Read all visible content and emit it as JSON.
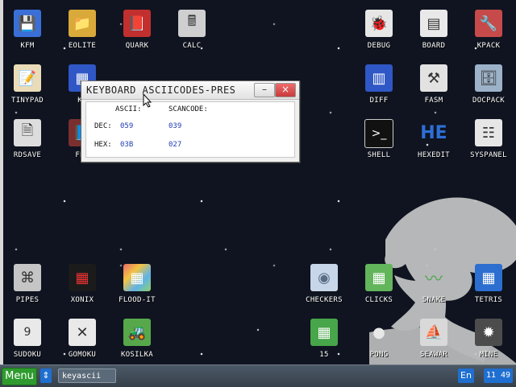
{
  "desktop": {
    "icons": [
      {
        "label": "KFM",
        "glyph": "💾",
        "color": "#3a6fd8"
      },
      {
        "label": "EOLITE",
        "glyph": "📁",
        "color": "#d9a93a"
      },
      {
        "label": "QUARK",
        "glyph": "📕",
        "color": "#c22f2f"
      },
      {
        "label": "CALC",
        "glyph": "🖩",
        "color": "#cfcfcf"
      },
      {
        "label": "DEBUG",
        "glyph": "🐞",
        "color": "#e6e6e6"
      },
      {
        "label": "BOARD",
        "glyph": "▤",
        "color": "#e9e9e9"
      },
      {
        "label": "KPACK",
        "glyph": "🔧",
        "color": "#c74a4a"
      },
      {
        "label": "TINYPAD",
        "glyph": "📝",
        "color": "#eadcb8"
      },
      {
        "label": "KF",
        "glyph": "▦",
        "color": "#2f57c5"
      },
      {
        "label": "DIFF",
        "glyph": "▥",
        "color": "#2f57c5"
      },
      {
        "label": "FASM",
        "glyph": "⚒",
        "color": "#e2e2e2"
      },
      {
        "label": "DOCPACK",
        "glyph": "🗄",
        "color": "#9cb2c8"
      },
      {
        "label": "RDSAVE",
        "glyph": "🗎",
        "color": "#dddddd"
      },
      {
        "label": "FB2",
        "glyph": "📘",
        "color": "#7a2f2f"
      },
      {
        "label": "SHELL",
        "glyph": ">_",
        "color": "#111111"
      },
      {
        "label": "HEXEDIT",
        "glyph": "HE",
        "color": "#2d6fd6"
      },
      {
        "label": "SYSPANEL",
        "glyph": "☷",
        "color": "#e6e6e6"
      },
      {
        "label": "PIPES",
        "glyph": "⌘",
        "color": "#c5c5c5"
      },
      {
        "label": "XONIX",
        "glyph": "▦",
        "color": "#1b1b1b"
      },
      {
        "label": "FLOOD-IT",
        "glyph": "▦",
        "color": "#e86a6a"
      },
      {
        "label": "CHECKERS",
        "glyph": "◉",
        "color": "#c7d6e8"
      },
      {
        "label": "CLICKS",
        "glyph": "▦",
        "color": "#62b55b"
      },
      {
        "label": "SNAKE",
        "glyph": "〰",
        "color": "#4fa64f"
      },
      {
        "label": "TETRIS",
        "glyph": "▦",
        "color": "#2c6fd0"
      },
      {
        "label": "SUDOKU",
        "glyph": "9",
        "color": "#e9e9e9"
      },
      {
        "label": "GOMOKU",
        "glyph": "✕",
        "color": "#e9e9e9"
      },
      {
        "label": "KOSILKA",
        "glyph": "🚜",
        "color": "#57a84b"
      },
      {
        "label": "15",
        "glyph": "▦",
        "color": "#47a54a"
      },
      {
        "label": "PONG",
        "glyph": "●",
        "color": "#e8e8e8"
      },
      {
        "label": "SEAWAR",
        "glyph": "⛵",
        "color": "#d9d9d9"
      },
      {
        "label": "MINE",
        "glyph": "✹",
        "color": "#4c4c4c"
      }
    ]
  },
  "window": {
    "title": "KEYBOARD ASCIICODES-PRES",
    "min_symbol": "–",
    "close_symbol": "×",
    "ascii_header": "ASCII:",
    "scancode_header": "SCANCODE:",
    "dec_label": "DEC:",
    "hex_label": "HEX:",
    "dec_ascii": "059",
    "dec_scan": "039",
    "hex_ascii": "03B",
    "hex_scan": "027"
  },
  "taskbar": {
    "menu_label": "Menu",
    "switch_symbol": "⇕",
    "task_label": "keyascii",
    "lang": "En",
    "time": "11 49"
  }
}
